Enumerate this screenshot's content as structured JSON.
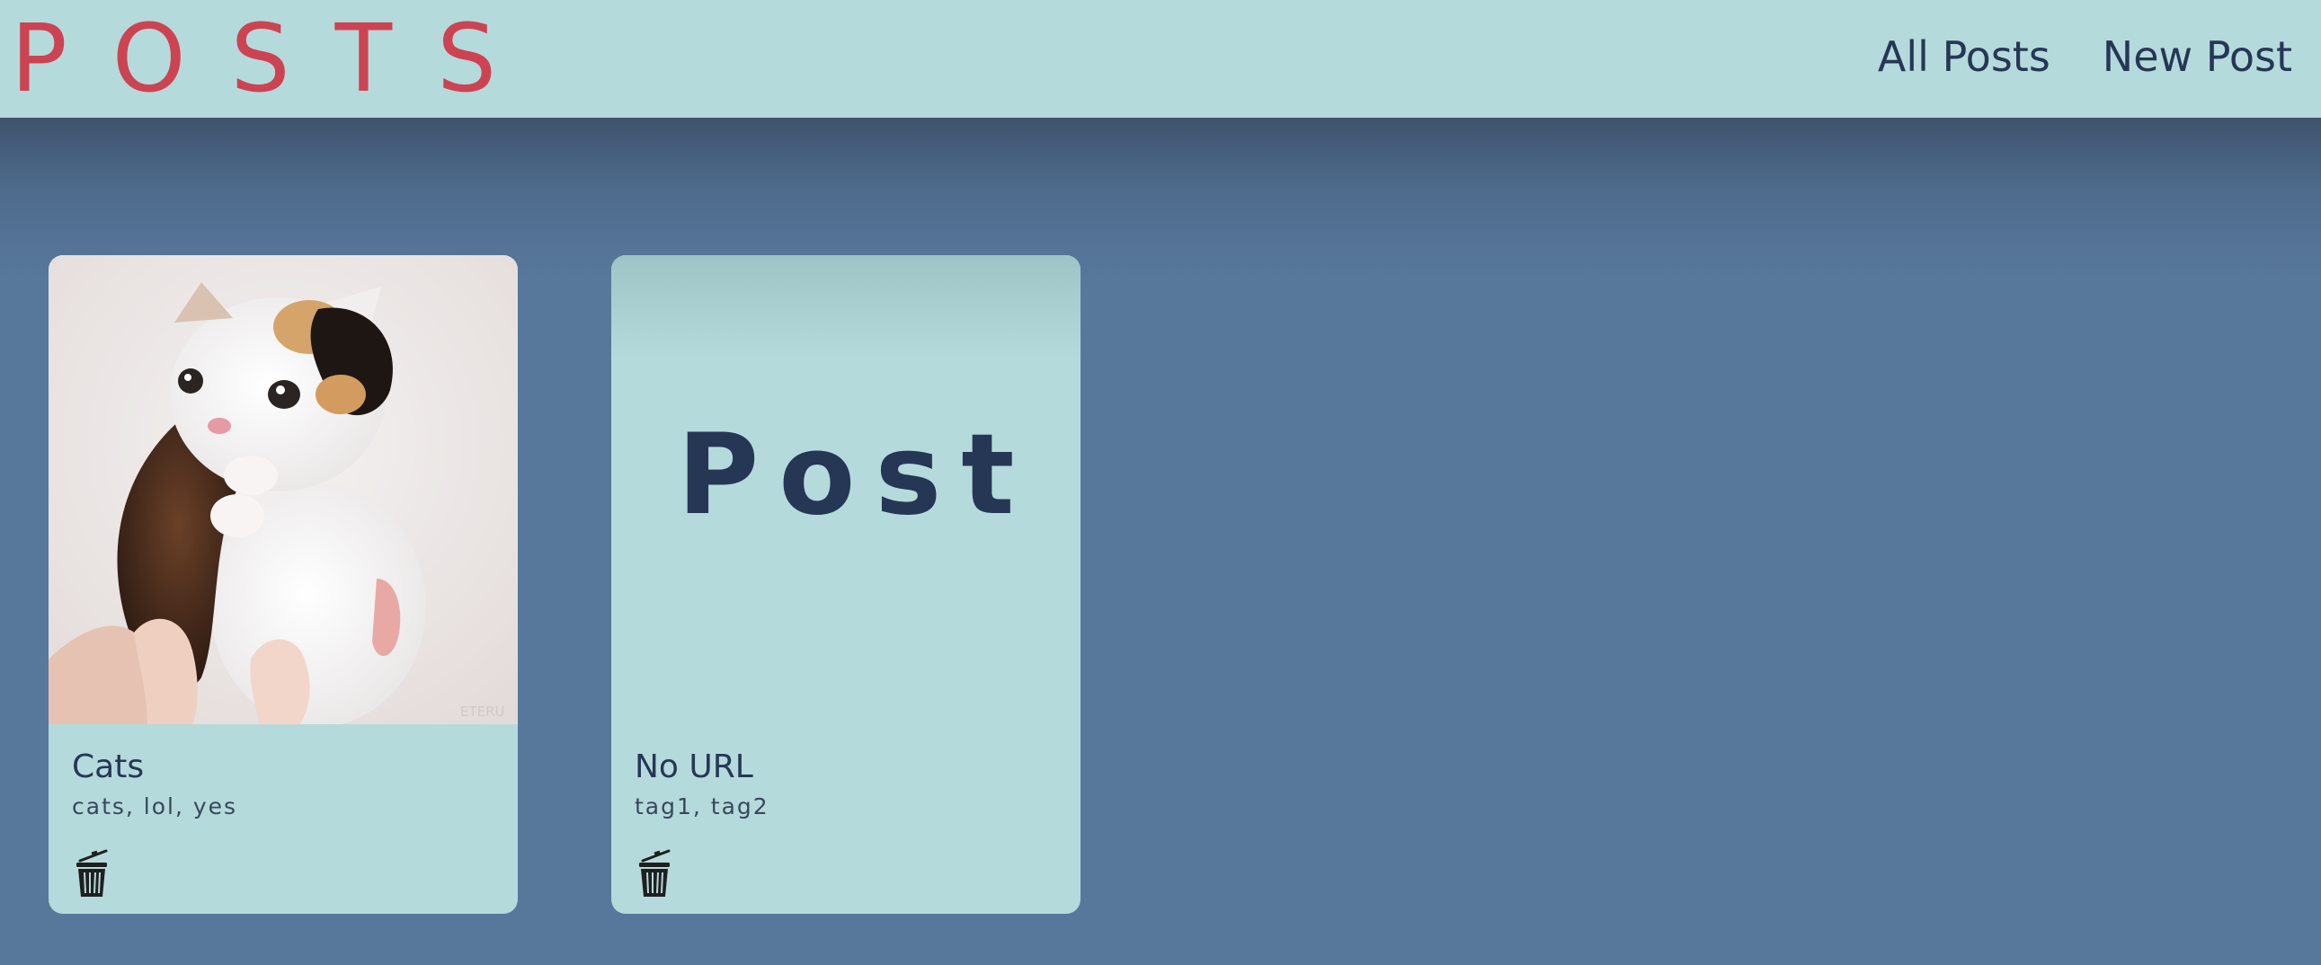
{
  "header": {
    "logo": "POSTS",
    "nav": [
      "All Posts",
      "New Post"
    ]
  },
  "posts": [
    {
      "title": "Cats",
      "tags": "cats, lol, yes",
      "image": "kitten photo",
      "watermark": "ETERU"
    },
    {
      "title": "No URL",
      "tags": "tag1, tag2",
      "placeholder": "Post"
    }
  ],
  "icons": {
    "delete": "trash-can-icon"
  },
  "colors": {
    "header_bg": "#b5dadb",
    "page_bg": "#58789b",
    "logo": "#cc4352",
    "text_dark": "#263756"
  }
}
